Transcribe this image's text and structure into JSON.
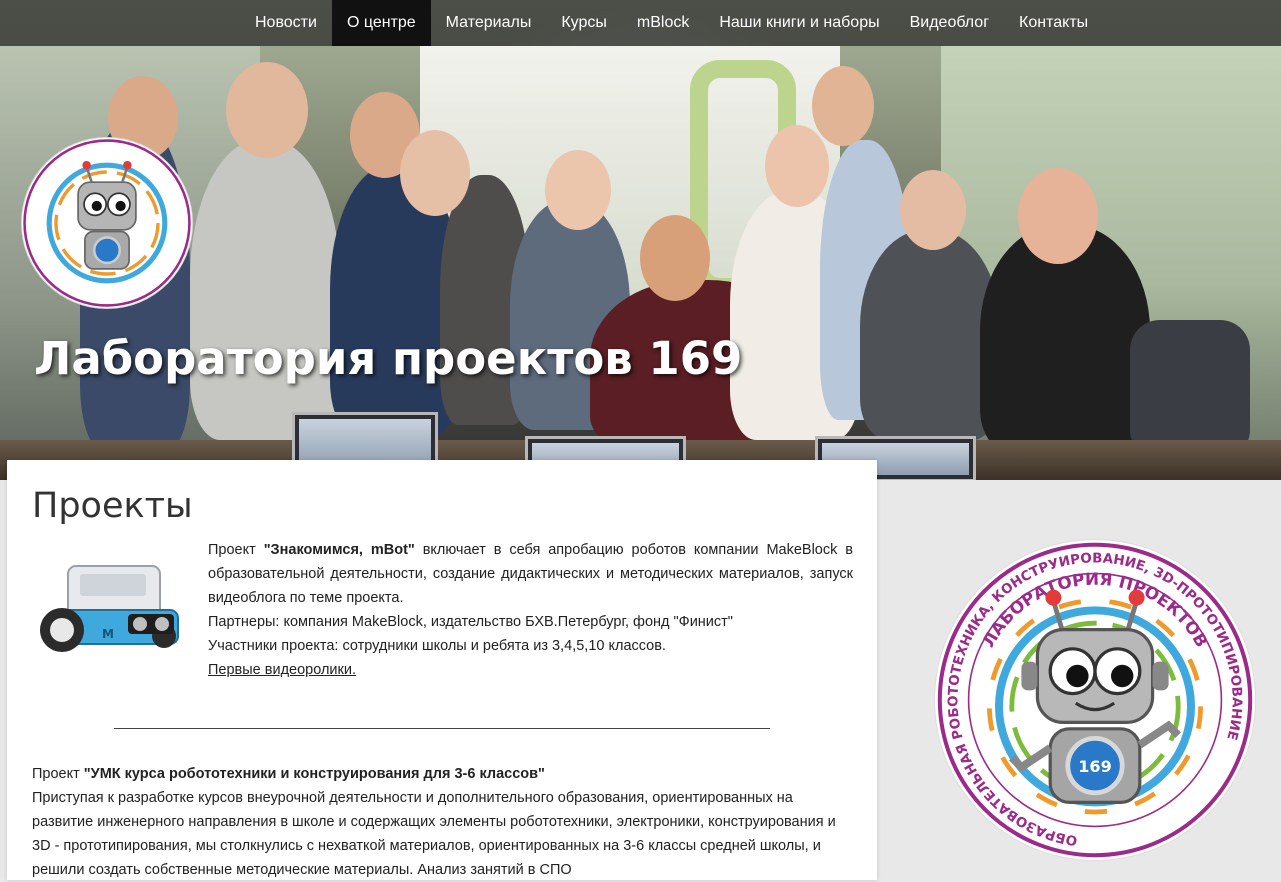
{
  "nav": {
    "items": [
      {
        "label": "Новости",
        "active": false
      },
      {
        "label": "О центре",
        "active": true
      },
      {
        "label": "Материалы",
        "active": false
      },
      {
        "label": "Курсы",
        "active": false
      },
      {
        "label": "mBlock",
        "active": false
      },
      {
        "label": "Наши книги и наборы",
        "active": false
      },
      {
        "label": "Видеоблог",
        "active": false
      },
      {
        "label": "Контакты",
        "active": false
      }
    ]
  },
  "hero": {
    "title": "Лаборатория проектов 169"
  },
  "logo": {
    "top_text": "ЛАБОРАТОРИЯ ПРОЕКТОВ",
    "ring_text": "ОБРАЗОВАТЕЛЬНАЯ РОБОТОТЕХНИКА, КОНСТРУИРОВАНИЕ, 3D-ПРОТОТИПИРОВАНИЕ",
    "robot_number": "169"
  },
  "section": {
    "title": "Проекты"
  },
  "project1": {
    "intro": "Проект ",
    "name": "\"Знакомимся, mBot\"",
    "text": " включает в себя апробацию роботов компании MakeBlock в образовательной деятельности, создание дидактических и методических материалов, запуск видеоблога по теме проекта.",
    "partners": "Партнеры: компания MakeBlock, издательство БХВ.Петербург, фонд \"Финист\"",
    "participants": "Участники проекта: сотрудники школы и ребята из 3,4,5,10 классов.",
    "link": "Первые видеоролики."
  },
  "project2": {
    "intro": "Проект ",
    "name": "\"УМК курса робототехники и конструирования для 3-6 классов\"",
    "text": "Приступая к разработке курсов внеурочной деятельности и дополнительного образования, ориентированных на развитие инженерного направления в школе и содержащих элементы робототехники, электроники, конструирования и 3D - прототипирования, мы столкнулись с нехваткой материалов, ориентированных на 3-6 классы средней школы, и решили создать собственные методические материалы. Анализ занятий в СПО"
  },
  "colors": {
    "nav_bg": "#282828",
    "nav_active": "#111111",
    "card_bg": "#ffffff",
    "logo_purple": "#9c2a8a",
    "mbot_blue": "#3fa8dc"
  }
}
